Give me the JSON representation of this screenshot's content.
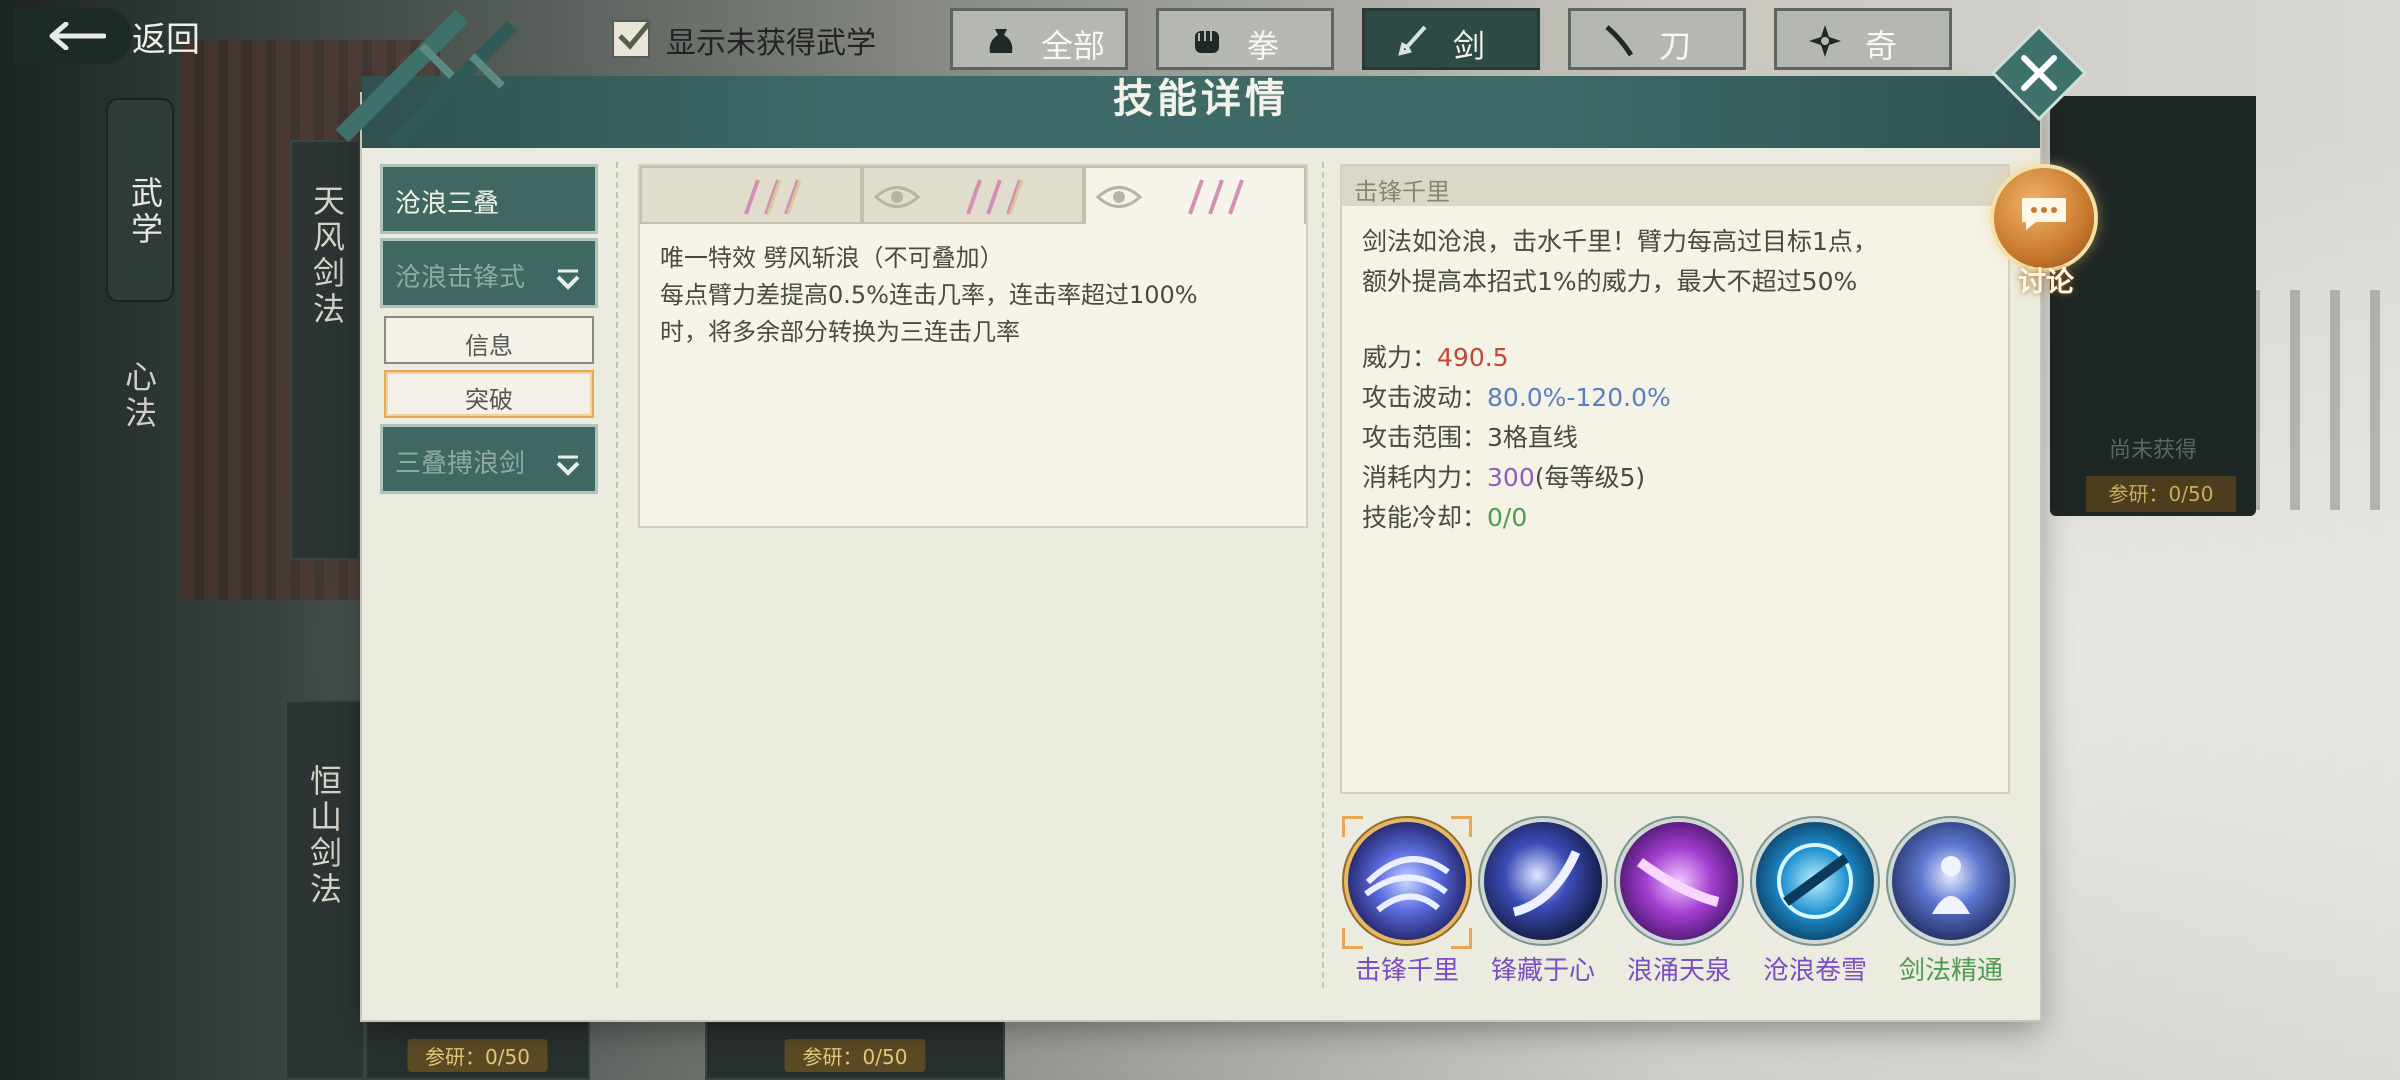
{
  "topbar": {
    "back_label": "返回",
    "toggle_label": "显示未获得武学",
    "toggle_checked": true,
    "filter_tabs": [
      {
        "label": "全部",
        "icon": "pouch-icon",
        "active": false
      },
      {
        "label": "拳",
        "icon": "fist-icon",
        "active": false
      },
      {
        "label": "剑",
        "icon": "sword-icon",
        "active": true
      },
      {
        "label": "刀",
        "icon": "blade-icon",
        "active": false
      },
      {
        "label": "奇",
        "icon": "shuriken-icon",
        "active": false
      }
    ]
  },
  "background": {
    "side_tab_martial": "武学",
    "side_tab_inner": "心法",
    "card_1_name": "天风剑法",
    "card_2_name": "恒山剑法",
    "unobtained": "尚未获得",
    "research_badge": "参研：0/50"
  },
  "modal": {
    "title": "技能详情",
    "nav": {
      "skill_1": "沧浪三叠",
      "skill_2": "沧浪击锋式",
      "sub_info": "信息",
      "sub_breakthrough": "突破",
      "skill_3": "三叠搏浪剑"
    },
    "effect_text": [
      "唯一特效 劈风斩浪（不可叠加）",
      "每点臂力差提高0.5%连击几率，连击率超过100%",
      "时，将多余部分转换为三连击几率"
    ],
    "detail": {
      "name": "击锋千里",
      "description": [
        "剑法如沧浪，击水千里！臂力每高过目标1点，",
        "额外提高本招式1%的威力，最大不超过50%"
      ],
      "stats": [
        {
          "label": "威力：",
          "value": "490.5",
          "color": "#c0483a",
          "suffix": ""
        },
        {
          "label": "攻击波动：",
          "value": "80.0%-120.0%",
          "color": "#5a7fc0",
          "suffix": ""
        },
        {
          "label": "攻击范围：",
          "value": "3格直线",
          "color": "#4a4a45",
          "suffix": ""
        },
        {
          "label": "消耗内力：",
          "value": "300",
          "color": "#8f5cc2",
          "suffix": "(每等级5)"
        },
        {
          "label": "技能冷却：",
          "value": "0/0",
          "color": "#4e9a55",
          "suffix": ""
        }
      ]
    },
    "skills": [
      {
        "name": "击锋千里",
        "selected": true,
        "name_color": "#7a4fc0"
      },
      {
        "name": "锋藏于心",
        "selected": false,
        "name_color": "#7a4fc0"
      },
      {
        "name": "浪涌天泉",
        "selected": false,
        "name_color": "#7a4fc0"
      },
      {
        "name": "沧浪卷雪",
        "selected": false,
        "name_color": "#7a4fc0"
      },
      {
        "name": "剑法精通",
        "selected": false,
        "name_color": "#4e9a55"
      }
    ],
    "discuss_label": "讨论"
  }
}
